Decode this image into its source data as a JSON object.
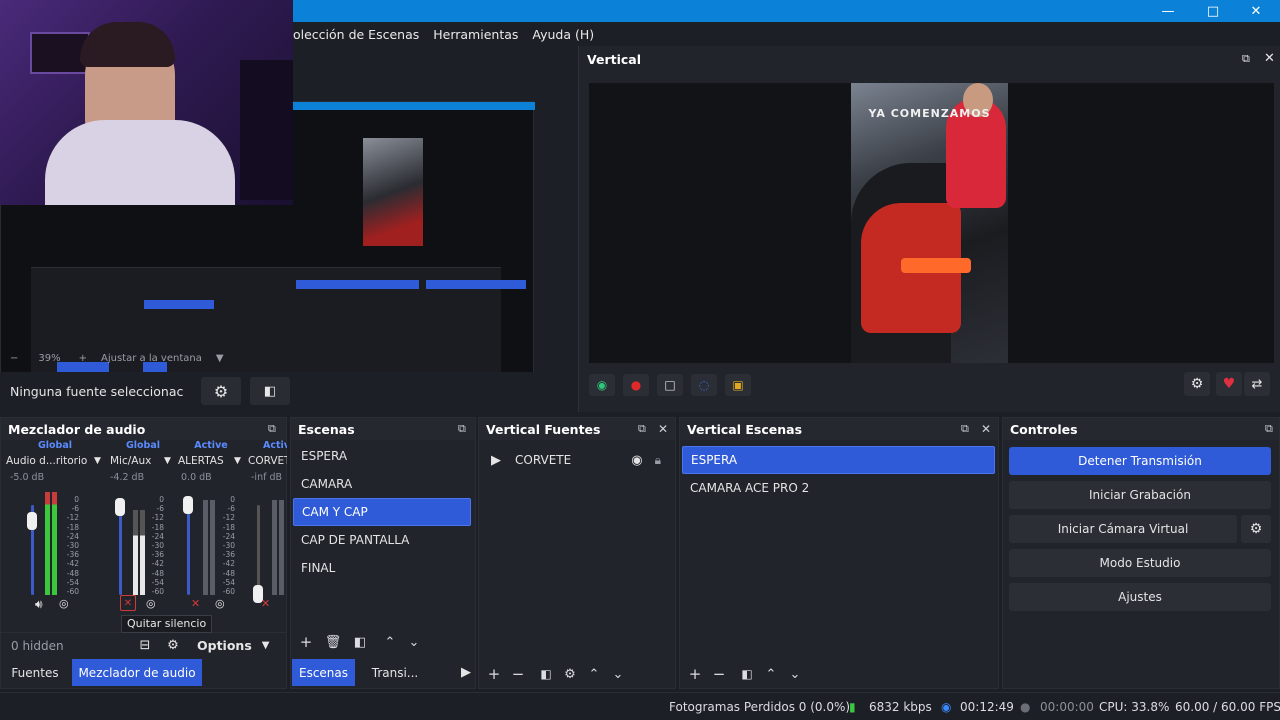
{
  "menu": [
    "Colección de Escenas",
    "Herramientas",
    "Ayuda (H)"
  ],
  "menu_first_visible": "olección de Escenas",
  "window_controls": {
    "minimize": "—",
    "maximize": "□",
    "close": "✕"
  },
  "preview": {
    "zoom": "39%",
    "zoom_minus": "−",
    "zoom_plus": "+",
    "fit_window": "Ajustar a la ventana",
    "no_source": "Ninguna fuente seleccionac"
  },
  "vertical": {
    "title": "Vertical",
    "overlay_text": "YA COMENZAMOS"
  },
  "mixer": {
    "title": "Mezclador de audio",
    "channels": [
      {
        "status": "Global",
        "name": "Audio d...ritorio",
        "db": "-5.0 dB",
        "level": 0.8
      },
      {
        "status": "Global",
        "name": "Mic/Aux",
        "db": "-4.2 dB",
        "level": 0.82
      },
      {
        "status": "Active",
        "name": "ALERTAS",
        "db": "0.0 dB",
        "level": 0.88
      },
      {
        "status": "Activ",
        "name": "CORVETE",
        "db": "-inf dB",
        "level": 0.1
      }
    ],
    "scale": [
      "0",
      "-6",
      "-12",
      "-18",
      "-24",
      "-30",
      "-36",
      "-42",
      "-48",
      "-54",
      "-60"
    ],
    "hidden": "0 hidden",
    "options": "Options",
    "tooltip": "Quitar silencio"
  },
  "scenes": {
    "title": "Escenas",
    "items": [
      "ESPERA",
      "CAMARA",
      "CAM Y CAP",
      "CAP DE PANTALLA",
      "FINAL"
    ],
    "selected_index": 2
  },
  "vertical_sources": {
    "title": "Vertical Fuentes",
    "items": [
      "CORVETE"
    ]
  },
  "vertical_scenes": {
    "title": "Vertical Escenas",
    "items": [
      "ESPERA",
      "CAMARA ACE PRO 2"
    ],
    "selected_index": 0
  },
  "controls": {
    "title": "Controles",
    "buttons": [
      "Detener Transmisión",
      "Iniciar Grabación",
      "Iniciar Cámara Virtual",
      "Modo Estudio",
      "Ajustes"
    ]
  },
  "tabs": {
    "left": [
      "Fuentes",
      "Mezclador de audio"
    ],
    "middle": [
      "Escenas",
      "Transi..."
    ]
  },
  "status": {
    "dropped": "Fotogramas Perdidos 0 (0.0%)",
    "kbps": "6832 kbps",
    "stream_time": "00:12:49",
    "rec_time": "00:00:00",
    "cpu": "CPU: 33.8%",
    "fps": "60.00 / 60.00 FPS"
  },
  "colors": {
    "accent": "#2f5bd8",
    "titlebar": "#0c81d8",
    "meter_green": "#3cc83c",
    "meter_red": "#c83c3c",
    "mute_red": "#d23a3a"
  }
}
